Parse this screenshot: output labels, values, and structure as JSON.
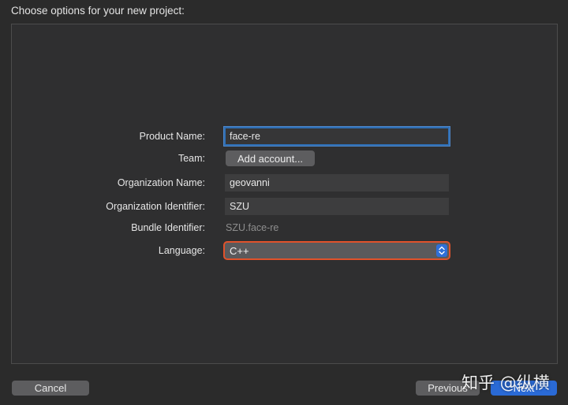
{
  "header": {
    "title": "Choose options for your new project:"
  },
  "form": {
    "product_name": {
      "label": "Product Name:",
      "value": "face-re"
    },
    "team": {
      "label": "Team:",
      "button_label": "Add account..."
    },
    "organization_name": {
      "label": "Organization Name:",
      "value": "geovanni"
    },
    "organization_identifier": {
      "label": "Organization Identifier:",
      "value": "SZU"
    },
    "bundle_identifier": {
      "label": "Bundle Identifier:",
      "value": "SZU.face-re"
    },
    "language": {
      "label": "Language:",
      "selected": "C++"
    }
  },
  "footer": {
    "cancel_label": "Cancel",
    "previous_label": "Previous",
    "next_label": "Next"
  },
  "watermark": {
    "text": "知乎 @纵横"
  },
  "colors": {
    "focus_ring": "#2f6fb5",
    "language_highlight": "#e0522b",
    "primary_button": "#2a6ad6"
  }
}
